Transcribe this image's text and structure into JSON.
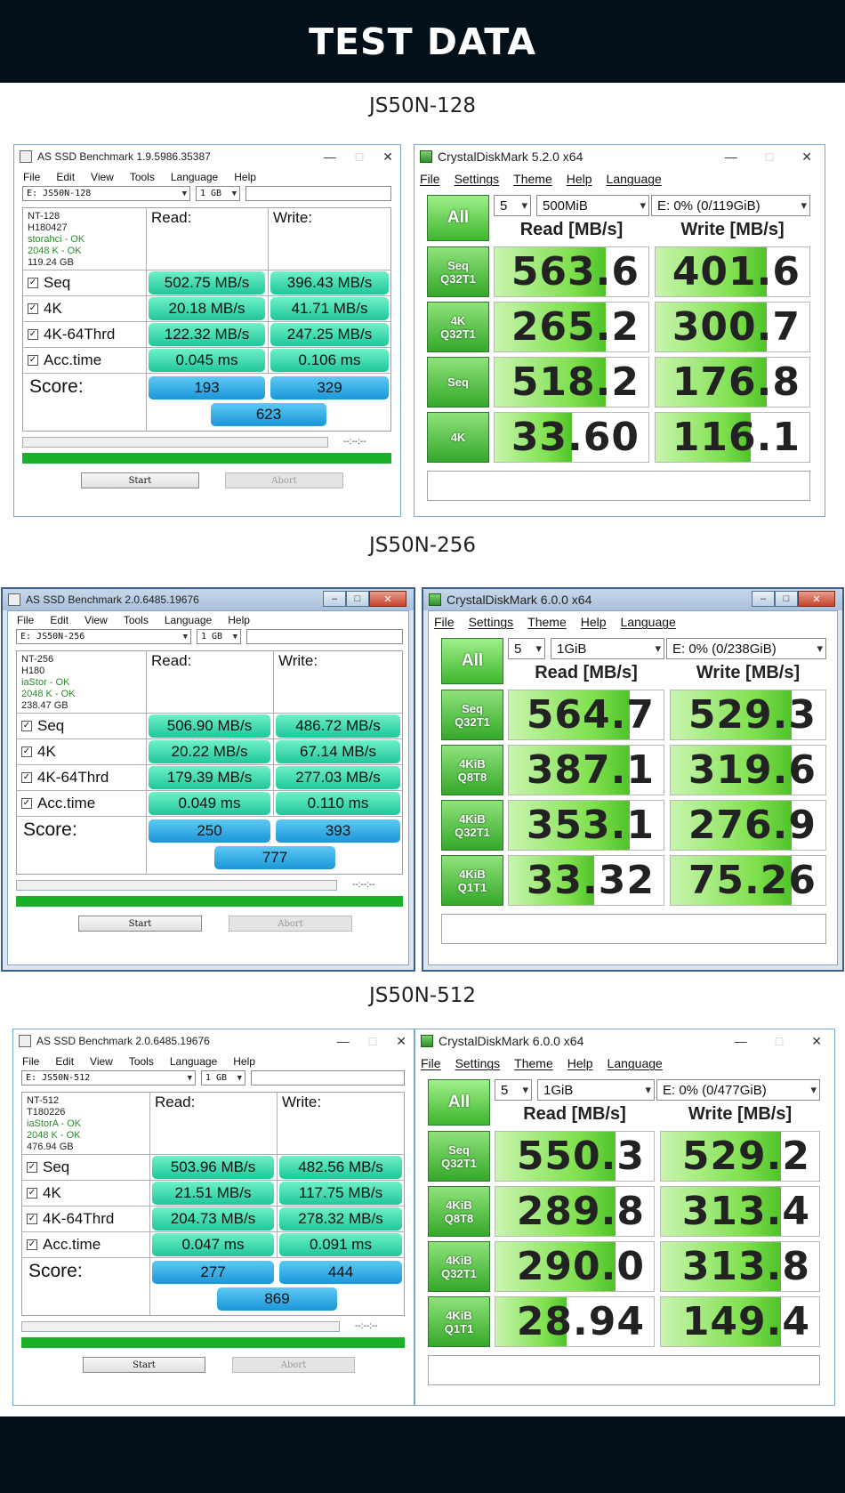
{
  "banner_title": "TEST DATA",
  "panels": [
    {
      "model": "JS50N-128",
      "asssd": {
        "title": "AS SSD Benchmark 1.9.5986.35387",
        "menu": [
          "File",
          "Edit",
          "View",
          "Tools",
          "Language",
          "Help"
        ],
        "drive": "E: JS50N-128",
        "size": "1 GB",
        "info": [
          "NT-128",
          "H180427",
          "storahci - OK",
          "2048 K - OK",
          "119.24 GB"
        ],
        "read_label": "Read:",
        "write_label": "Write:",
        "rows": [
          {
            "label": "Seq",
            "read": "502.75 MB/s",
            "write": "396.43 MB/s"
          },
          {
            "label": "4K",
            "read": "20.18 MB/s",
            "write": "41.71 MB/s"
          },
          {
            "label": "4K-64Thrd",
            "read": "122.32 MB/s",
            "write": "247.25 MB/s"
          },
          {
            "label": "Acc.time",
            "read": "0.045 ms",
            "write": "0.106 ms"
          }
        ],
        "score_label": "Score:",
        "score_read": "193",
        "score_write": "329",
        "score_total": "623",
        "time": "--:--:--",
        "start": "Start",
        "abort": "Abort"
      },
      "cdm": {
        "title": "CrystalDiskMark 5.2.0 x64",
        "menu": [
          "File",
          "Settings",
          "Theme",
          "Help",
          "Language"
        ],
        "all": "All",
        "count": "5",
        "size": "500MiB",
        "drive": "E: 0% (0/119GiB)",
        "read_hdr": "Read [MB/s]",
        "write_hdr": "Write [MB/s]",
        "rows": [
          {
            "l1": "Seq",
            "l2": "Q32T1",
            "read": "563.6",
            "write": "401.6",
            "rf": 0.72,
            "wf": 0.72
          },
          {
            "l1": "4K",
            "l2": "Q32T1",
            "read": "265.2",
            "write": "300.7",
            "rf": 0.72,
            "wf": 0.72
          },
          {
            "l1": "Seq",
            "l2": "",
            "read": "518.2",
            "write": "176.8",
            "rf": 0.72,
            "wf": 0.72
          },
          {
            "l1": "4K",
            "l2": "",
            "read": "33.60",
            "write": "116.1",
            "rf": 0.5,
            "wf": 0.62
          }
        ]
      }
    },
    {
      "model": "JS50N-256",
      "asssd": {
        "title": "AS SSD Benchmark 2.0.6485.19676",
        "menu": [
          "File",
          "Edit",
          "View",
          "Tools",
          "Language",
          "Help"
        ],
        "drive": "E: JS50N-256",
        "size": "1 GB",
        "info": [
          "NT-256",
          "H180",
          "iaStor - OK",
          "2048 K - OK",
          "238.47 GB"
        ],
        "read_label": "Read:",
        "write_label": "Write:",
        "rows": [
          {
            "label": "Seq",
            "read": "506.90 MB/s",
            "write": "486.72 MB/s"
          },
          {
            "label": "4K",
            "read": "20.22 MB/s",
            "write": "67.14 MB/s"
          },
          {
            "label": "4K-64Thrd",
            "read": "179.39 MB/s",
            "write": "277.03 MB/s"
          },
          {
            "label": "Acc.time",
            "read": "0.049 ms",
            "write": "0.110 ms"
          }
        ],
        "score_label": "Score:",
        "score_read": "250",
        "score_write": "393",
        "score_total": "777",
        "time": "--:--:--",
        "start": "Start",
        "abort": "Abort"
      },
      "cdm": {
        "title": "CrystalDiskMark 6.0.0 x64",
        "menu": [
          "File",
          "Settings",
          "Theme",
          "Help",
          "Language"
        ],
        "all": "All",
        "count": "5",
        "size": "1GiB",
        "drive": "E: 0% (0/238GiB)",
        "read_hdr": "Read [MB/s]",
        "write_hdr": "Write [MB/s]",
        "rows": [
          {
            "l1": "Seq",
            "l2": "Q32T1",
            "read": "564.7",
            "write": "529.3",
            "rf": 0.78,
            "wf": 0.78
          },
          {
            "l1": "4KiB",
            "l2": "Q8T8",
            "read": "387.1",
            "write": "319.6",
            "rf": 0.78,
            "wf": 0.78
          },
          {
            "l1": "4KiB",
            "l2": "Q32T1",
            "read": "353.1",
            "write": "276.9",
            "rf": 0.78,
            "wf": 0.78
          },
          {
            "l1": "4KiB",
            "l2": "Q1T1",
            "read": "33.32",
            "write": "75.26",
            "rf": 0.55,
            "wf": 0.78
          }
        ]
      }
    },
    {
      "model": "JS50N-512",
      "asssd": {
        "title": "AS SSD Benchmark 2.0.6485.19676",
        "menu": [
          "File",
          "Edit",
          "View",
          "Tools",
          "Language",
          "Help"
        ],
        "drive": "E: JS50N-512",
        "size": "1 GB",
        "info": [
          "NT-512",
          "T180226",
          "iaStorA - OK",
          "2048 K - OK",
          "476.94 GB"
        ],
        "read_label": "Read:",
        "write_label": "Write:",
        "rows": [
          {
            "label": "Seq",
            "read": "503.96 MB/s",
            "write": "482.56 MB/s"
          },
          {
            "label": "4K",
            "read": "21.51 MB/s",
            "write": "117.75 MB/s"
          },
          {
            "label": "4K-64Thrd",
            "read": "204.73 MB/s",
            "write": "278.32 MB/s"
          },
          {
            "label": "Acc.time",
            "read": "0.047 ms",
            "write": "0.091 ms"
          }
        ],
        "score_label": "Score:",
        "score_read": "277",
        "score_write": "444",
        "score_total": "869",
        "time": "--:--:--",
        "start": "Start",
        "abort": "Abort"
      },
      "cdm": {
        "title": "CrystalDiskMark 6.0.0 x64",
        "menu": [
          "File",
          "Settings",
          "Theme",
          "Help",
          "Language"
        ],
        "all": "All",
        "count": "5",
        "size": "1GiB",
        "drive": "E: 0% (0/477GiB)",
        "read_hdr": "Read [MB/s]",
        "write_hdr": "Write [MB/s]",
        "rows": [
          {
            "l1": "Seq",
            "l2": "Q32T1",
            "read": "550.3",
            "write": "529.2",
            "rf": 0.76,
            "wf": 0.76
          },
          {
            "l1": "4KiB",
            "l2": "Q8T8",
            "read": "289.8",
            "write": "313.4",
            "rf": 0.76,
            "wf": 0.76
          },
          {
            "l1": "4KiB",
            "l2": "Q32T1",
            "read": "290.0",
            "write": "313.8",
            "rf": 0.76,
            "wf": 0.76
          },
          {
            "l1": "4KiB",
            "l2": "Q1T1",
            "read": "28.94",
            "write": "149.4",
            "rf": 0.45,
            "wf": 0.76
          }
        ]
      }
    }
  ]
}
